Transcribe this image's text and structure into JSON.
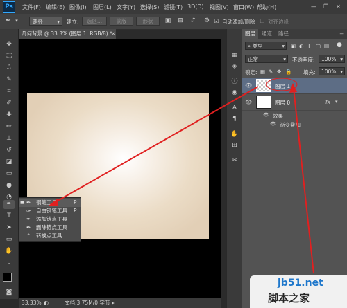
{
  "app": {
    "logo": "Ps"
  },
  "menu": [
    "文件(F)",
    "编辑(E)",
    "图像(I)",
    "图层(L)",
    "文字(Y)",
    "选择(S)",
    "滤镜(T)",
    "3D(D)",
    "视图(V)",
    "窗口(W)",
    "帮助(H)"
  ],
  "options": {
    "mode_value": "路径",
    "build_label": "建立:",
    "selection_btn": "选区...",
    "mask_btn": "蒙版",
    "shape_btn": "形状",
    "auto_add_delete": "自动添加/删除",
    "align_edges": "对齐边缘"
  },
  "document": {
    "tab_title": "几何背景 @ 33.3% (图层 1, RGB/8) *",
    "zoom": "33.33%",
    "doc_info": "文档:3.75M/0 字节"
  },
  "tool_flyout": {
    "items": [
      {
        "label": "钢笔工具",
        "shortcut": "P",
        "selected": true
      },
      {
        "label": "自由钢笔工具",
        "shortcut": "P"
      },
      {
        "label": "添加锚点工具",
        "shortcut": ""
      },
      {
        "label": "删除锚点工具",
        "shortcut": ""
      },
      {
        "label": "转换点工具",
        "shortcut": ""
      }
    ]
  },
  "layers_panel": {
    "tabs": [
      "图层",
      "通道",
      "路径"
    ],
    "filter_label": "类型",
    "blend_mode": "正常",
    "opacity_label": "不透明度:",
    "opacity_value": "100%",
    "lock_label": "锁定:",
    "fill_label": "填充:",
    "fill_value": "100%",
    "layers": [
      {
        "name": "图层 1"
      },
      {
        "name": "图层 0",
        "fx": "fx"
      }
    ],
    "effects_label": "效果",
    "effect_item": "渐变叠加"
  },
  "watermark": {
    "url": "jb51.net",
    "text": "脚本之家"
  },
  "colors": {
    "accent": "#31a8ff",
    "annotation_arrow": "#e02020",
    "selected_layer": "#5d6d85"
  }
}
